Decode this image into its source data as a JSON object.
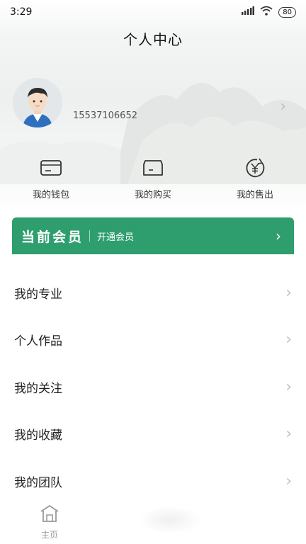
{
  "status": {
    "time": "3:29",
    "battery": "80"
  },
  "header": {
    "title": "个人中心"
  },
  "profile": {
    "phone": "15537106652"
  },
  "quick_actions": [
    {
      "label": "我的钱包",
      "icon": "wallet-icon"
    },
    {
      "label": "我的购买",
      "icon": "purchase-box-icon"
    },
    {
      "label": "我的售出",
      "icon": "yen-icon"
    }
  ],
  "vip": {
    "title": "当前会员",
    "subtitle": "开通会员",
    "color": "#2e9e6e"
  },
  "menu": [
    {
      "label": "我的专业"
    },
    {
      "label": "个人作品"
    },
    {
      "label": "我的关注"
    },
    {
      "label": "我的收藏"
    },
    {
      "label": "我的团队"
    }
  ],
  "tabbar": {
    "home_label": "主页"
  }
}
